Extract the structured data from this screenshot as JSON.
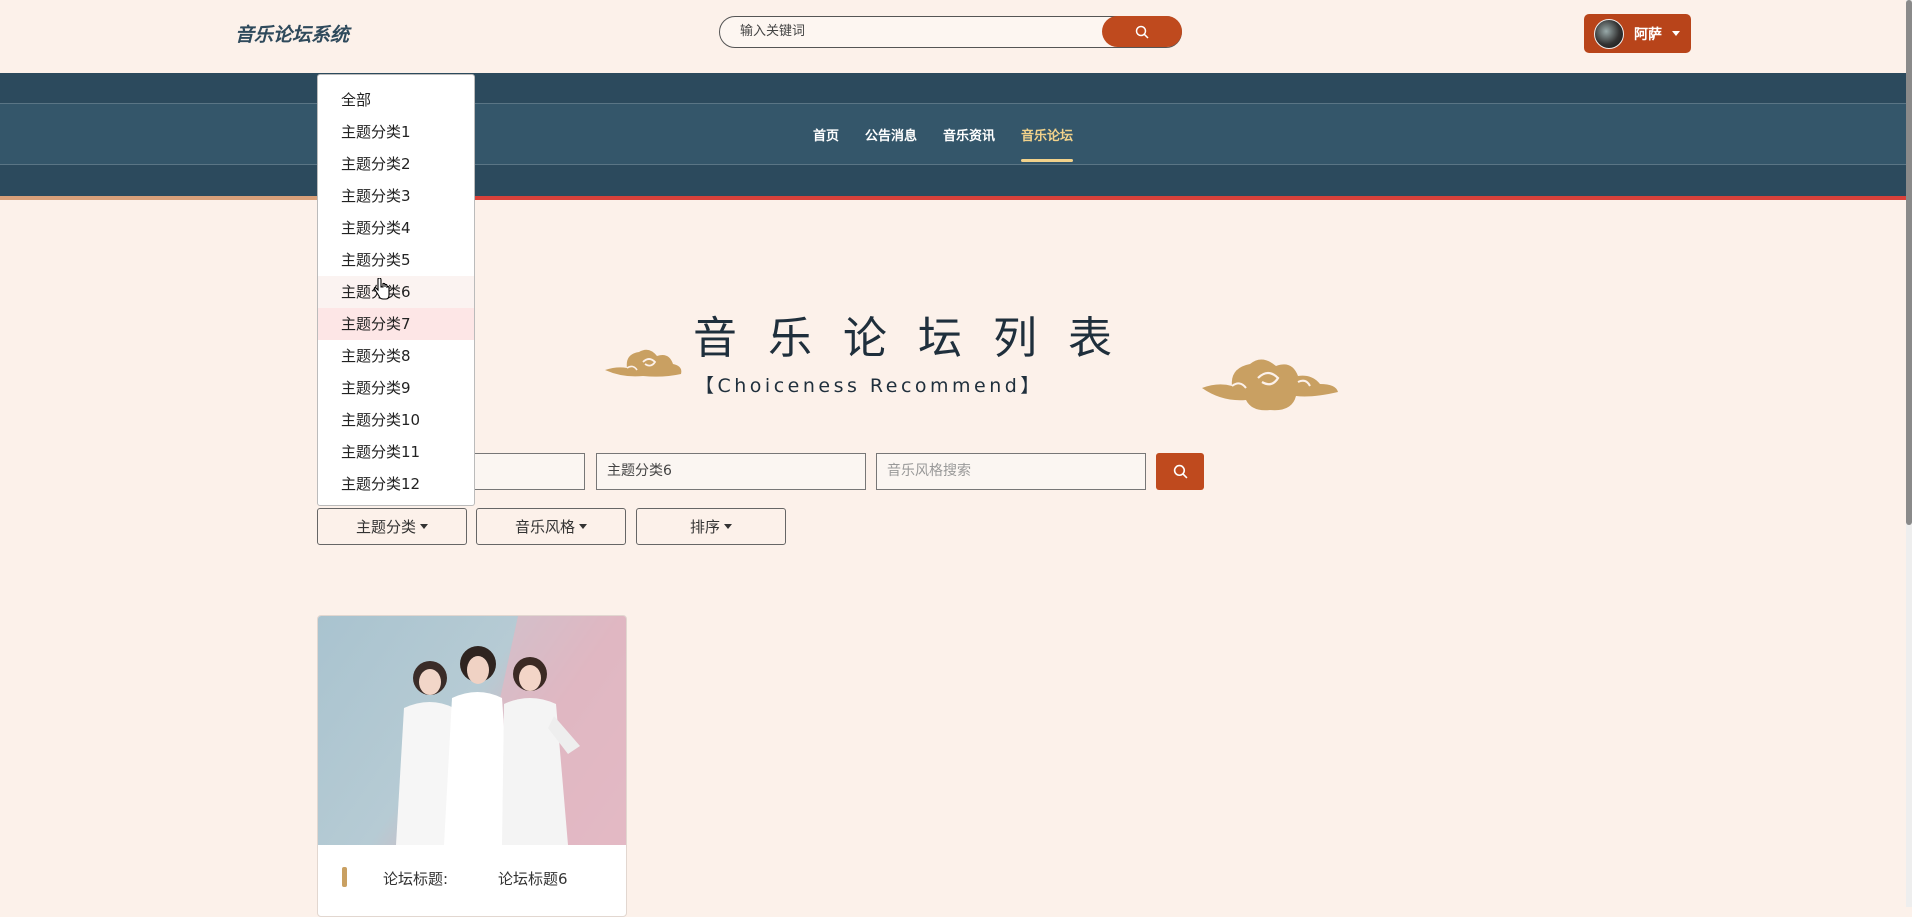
{
  "header": {
    "logo": "音乐论坛系统",
    "search_placeholder": "输入关键词",
    "user_name": "阿萨"
  },
  "nav": {
    "items": [
      "首页",
      "公告消息",
      "音乐资讯",
      "音乐论坛"
    ],
    "active": "音乐论坛"
  },
  "page": {
    "title": "音乐论坛列表",
    "subtitle": "【Choiceness Recommend】"
  },
  "filters": {
    "title_field_value": "",
    "category_field_value": "主题分类6",
    "style_placeholder": "音乐风格搜索",
    "dropdowns": [
      "主题分类",
      "音乐风格",
      "排序"
    ]
  },
  "category_menu": {
    "items": [
      "全部",
      "主题分类1",
      "主题分类2",
      "主题分类3",
      "主题分类4",
      "主题分类5",
      "主题分类6",
      "主题分类7",
      "主题分类8",
      "主题分类9",
      "主题分类10",
      "主题分类11",
      "主题分类12"
    ],
    "hovered": "主题分类6",
    "selected": "主题分类7"
  },
  "cards": [
    {
      "label": "论坛标题:",
      "value": "论坛标题6"
    }
  ],
  "colors": {
    "accent": "#bf4a1e",
    "nav_bg": "#2c4a5d",
    "page_bg": "#fcf1ea",
    "active_nav": "#f2d28b",
    "cloud": "#c9a062"
  },
  "icons": [
    "search-icon",
    "chevron-down-icon",
    "cloud-icon",
    "avatar",
    "pointer-cursor-icon"
  ]
}
